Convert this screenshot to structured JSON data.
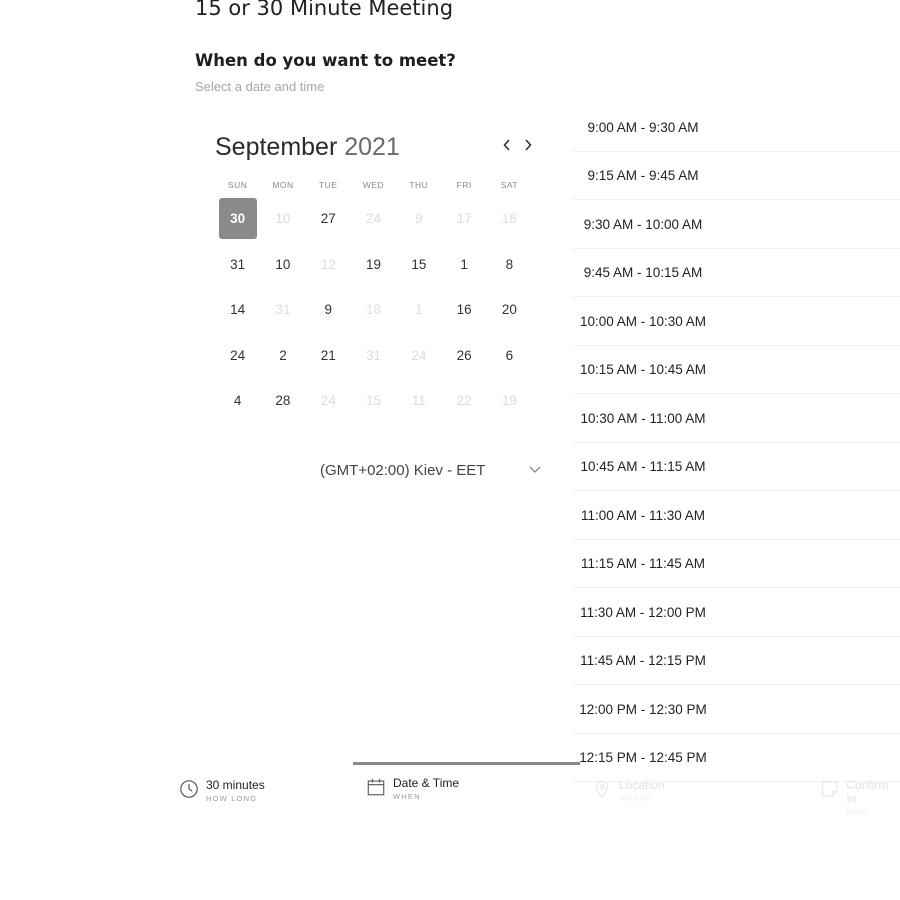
{
  "meeting": {
    "title": "15 or 30 Minute Meeting",
    "heading": "When do you want to meet?",
    "subheading": "Select a date and time"
  },
  "calendar": {
    "month": "September",
    "year": "2021",
    "prev_icon": "chevron-left-icon",
    "next_icon": "chevron-right-icon",
    "weekdays": [
      "SUN",
      "MON",
      "TUE",
      "WED",
      "THU",
      "FRI",
      "SAT"
    ],
    "weeks": [
      [
        {
          "d": "30",
          "s": "selected"
        },
        {
          "d": "10",
          "s": "disabled"
        },
        {
          "d": "27",
          "s": "available"
        },
        {
          "d": "24",
          "s": "disabled"
        },
        {
          "d": "9",
          "s": "disabled"
        },
        {
          "d": "17",
          "s": "disabled"
        },
        {
          "d": "18",
          "s": "disabled"
        }
      ],
      [
        {
          "d": "31",
          "s": "available"
        },
        {
          "d": "10",
          "s": "available"
        },
        {
          "d": "12",
          "s": "disabled"
        },
        {
          "d": "19",
          "s": "available"
        },
        {
          "d": "15",
          "s": "available"
        },
        {
          "d": "1",
          "s": "available"
        },
        {
          "d": "8",
          "s": "available"
        }
      ],
      [
        {
          "d": "14",
          "s": "available"
        },
        {
          "d": "31",
          "s": "disabled"
        },
        {
          "d": "9",
          "s": "available"
        },
        {
          "d": "18",
          "s": "disabled"
        },
        {
          "d": "1",
          "s": "disabled"
        },
        {
          "d": "16",
          "s": "available"
        },
        {
          "d": "20",
          "s": "available"
        }
      ],
      [
        {
          "d": "24",
          "s": "available"
        },
        {
          "d": "2",
          "s": "available"
        },
        {
          "d": "21",
          "s": "available"
        },
        {
          "d": "31",
          "s": "disabled"
        },
        {
          "d": "24",
          "s": "disabled"
        },
        {
          "d": "26",
          "s": "available"
        },
        {
          "d": "6",
          "s": "available"
        }
      ],
      [
        {
          "d": "4",
          "s": "available"
        },
        {
          "d": "28",
          "s": "available"
        },
        {
          "d": "24",
          "s": "disabled"
        },
        {
          "d": "15",
          "s": "disabled"
        },
        {
          "d": "11",
          "s": "disabled"
        },
        {
          "d": "22",
          "s": "disabled"
        },
        {
          "d": "19",
          "s": "disabled"
        }
      ]
    ],
    "timezone": "(GMT+02:00) Kiev - EET",
    "timezone_icon": "chevron-down-icon"
  },
  "time_slots": [
    "9:00 AM - 9:30 AM",
    "9:15 AM - 9:45 AM",
    "9:30 AM - 10:00 AM",
    "9:45 AM - 10:15 AM",
    "10:00 AM - 10:30 AM",
    "10:15 AM - 10:45 AM",
    "10:30 AM - 11:00 AM",
    "10:45 AM - 11:15 AM",
    "11:00 AM - 11:30 AM",
    "11:15 AM - 11:45 AM",
    "11:30 AM - 12:00 PM",
    "11:45 AM - 12:15 PM",
    "12:00 PM - 12:30 PM",
    "12:15 PM - 12:45 PM"
  ],
  "steps": [
    {
      "label": "30 minutes",
      "sub": "HOW LONG",
      "icon": "clock-icon",
      "state": "done"
    },
    {
      "label": "Date & Time",
      "sub": "WHEN",
      "icon": "calendar-icon",
      "state": "active"
    },
    {
      "label": "Location",
      "sub": "WHERE",
      "icon": "map-pin-icon",
      "state": "inactive"
    },
    {
      "label": "Confirm In",
      "sub": "WHO",
      "icon": "note-icon",
      "state": "inactive"
    }
  ],
  "colors": {
    "selected_day": "#8a8a8a",
    "active_step_bar": "#8a8a8a",
    "disabled_text": "#dcdcdc"
  }
}
